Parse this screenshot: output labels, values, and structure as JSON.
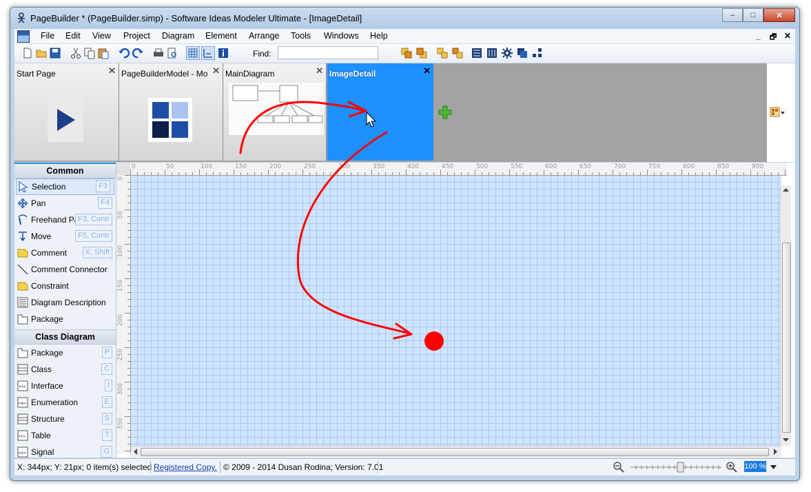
{
  "window": {
    "title": "PageBuilder *  (PageBuilder.simp)  - Software Ideas Modeler Ultimate - [ImageDetail]",
    "controls": {
      "minimize": "–",
      "maximize": "□",
      "close": "✕"
    }
  },
  "menu": {
    "items": [
      "File",
      "Edit",
      "View",
      "Project",
      "Diagram",
      "Element",
      "Arrange",
      "Tools",
      "Windows",
      "Help"
    ],
    "mdi_controls": [
      "_",
      "🗗",
      "✕"
    ]
  },
  "toolbar": {
    "find_label": "Find:",
    "find_value": ""
  },
  "tabs": [
    {
      "label": "Start Page",
      "close": "✕"
    },
    {
      "label": "PageBuilderModel - Mo...",
      "close": "✕"
    },
    {
      "label": "MainDiagram",
      "close": "✕"
    },
    {
      "label": "ImageDetail",
      "close": "✕",
      "active": true
    }
  ],
  "toolbox": {
    "sections": [
      {
        "title": "Common",
        "tools": [
          {
            "label": "Selection",
            "key": "F3",
            "selected": true
          },
          {
            "label": "Pan",
            "key": "F4"
          },
          {
            "label": "Freehand Pa",
            "key": "F3, Contr"
          },
          {
            "label": "Move",
            "key": "F5, Contr"
          },
          {
            "label": "Comment",
            "key": "X, Shift"
          },
          {
            "label": "Comment Connector",
            "key": ""
          },
          {
            "label": "Constraint",
            "key": ""
          },
          {
            "label": "Diagram Description",
            "key": ""
          },
          {
            "label": "Package",
            "key": ""
          }
        ]
      },
      {
        "title": "Class Diagram",
        "tools": [
          {
            "label": "Package",
            "key": "P"
          },
          {
            "label": "Class",
            "key": "C"
          },
          {
            "label": "Interface",
            "key": "I"
          },
          {
            "label": "Enumeration",
            "key": "E"
          },
          {
            "label": "Structure",
            "key": "S"
          },
          {
            "label": "Table",
            "key": "T"
          },
          {
            "label": "Signal",
            "key": "G"
          }
        ]
      }
    ]
  },
  "ruler": {
    "top_labels": [
      "0",
      "50",
      "100",
      "150",
      "200",
      "250",
      "300",
      "350",
      "400",
      "450",
      "500",
      "550",
      "600",
      "650",
      "700",
      "750",
      "800",
      "850",
      "900"
    ],
    "left_labels": [
      "0",
      "50",
      "100",
      "150",
      "200",
      "250",
      "300",
      "350"
    ]
  },
  "status": {
    "position": "X: 344px; Y: 21px; 0 item(s) selected",
    "registered": "Registered Copy.",
    "copyright": "© 2009 - 2014 Dusan Rodina; Version: 7.01",
    "zoom": "100 %"
  },
  "colors": {
    "active_tab": "#1e90ff",
    "canvas_bg": "#cfe4ff",
    "annotation_red": "#ff0000"
  }
}
